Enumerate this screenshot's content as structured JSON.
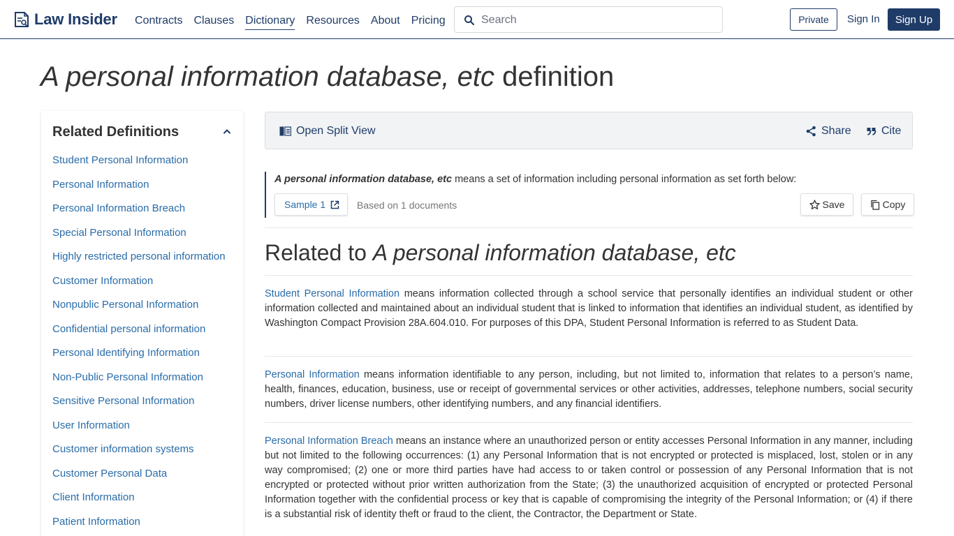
{
  "header": {
    "logo_text": "Law Insider",
    "nav": [
      "Contracts",
      "Clauses",
      "Dictionary",
      "Resources",
      "About",
      "Pricing"
    ],
    "active_nav": "Dictionary",
    "search_placeholder": "Search",
    "private_label": "Private",
    "signin_label": "Sign In",
    "signup_label": "Sign Up"
  },
  "page": {
    "title_term": "A personal information database, etc",
    "title_suffix": "definition"
  },
  "sidebar": {
    "title": "Related Definitions",
    "items": [
      "Student Personal Information",
      "Personal Information",
      "Personal Information Breach",
      "Special Personal Information",
      "Highly restricted personal information",
      "Customer Information",
      "Nonpublic Personal Information",
      "Confidential personal information",
      "Personal Identifying Information",
      "Non-Public Personal Information",
      "Sensitive Personal Information",
      "User Information",
      "Customer information systems",
      "Customer Personal Data",
      "Client Information",
      "Patient Information"
    ]
  },
  "toolbar": {
    "split_view": "Open Split View",
    "share": "Share",
    "cite": "Cite"
  },
  "definition": {
    "term": "A personal information database, etc",
    "text": " means a set of information including personal information as set forth below:",
    "sample_label": "Sample 1",
    "based_on": "Based on 1 documents",
    "save_label": "Save",
    "copy_label": "Copy"
  },
  "related": {
    "prefix": "Related to ",
    "term": "A personal information database, etc",
    "entries": [
      {
        "term": "Student Personal Information",
        "text": " means information collected through a school service that personally identifies an individual student or other information collected and maintained about an individual student that is linked to information that identifies an individual student, as identified by Washington Compact Provision 28A.604.010. For purposes of this DPA, Student Personal Information is referred to as Student Data."
      },
      {
        "term": "Personal Information",
        "text": " means information identifiable to any person, including, but not limited to, information that relates to a person’s name, health, finances, education, business, use or receipt of governmental services or other activities, addresses, telephone numbers, social security numbers, driver license numbers, other identifying numbers, and any financial identifiers."
      },
      {
        "term": "Personal Information Breach",
        "text": " means an instance where an unauthorized person or entity accesses Personal Information in any manner, including but not limited to the following occurrences: (1) any Personal Information that is not encrypted or protected is misplaced, lost, stolen or in any way compromised; (2) one or more third parties have had access to or taken control or possession of any Personal Information that is not encrypted or protected without prior written authorization from the State; (3) the unauthorized acquisition of encrypted or protected Personal Information together with the confidential process or key that is capable of compromising the integrity of the Personal Information; or (4) if there is a substantial risk of identity theft or fraud to the client, the Contractor, the Department or State."
      }
    ]
  }
}
